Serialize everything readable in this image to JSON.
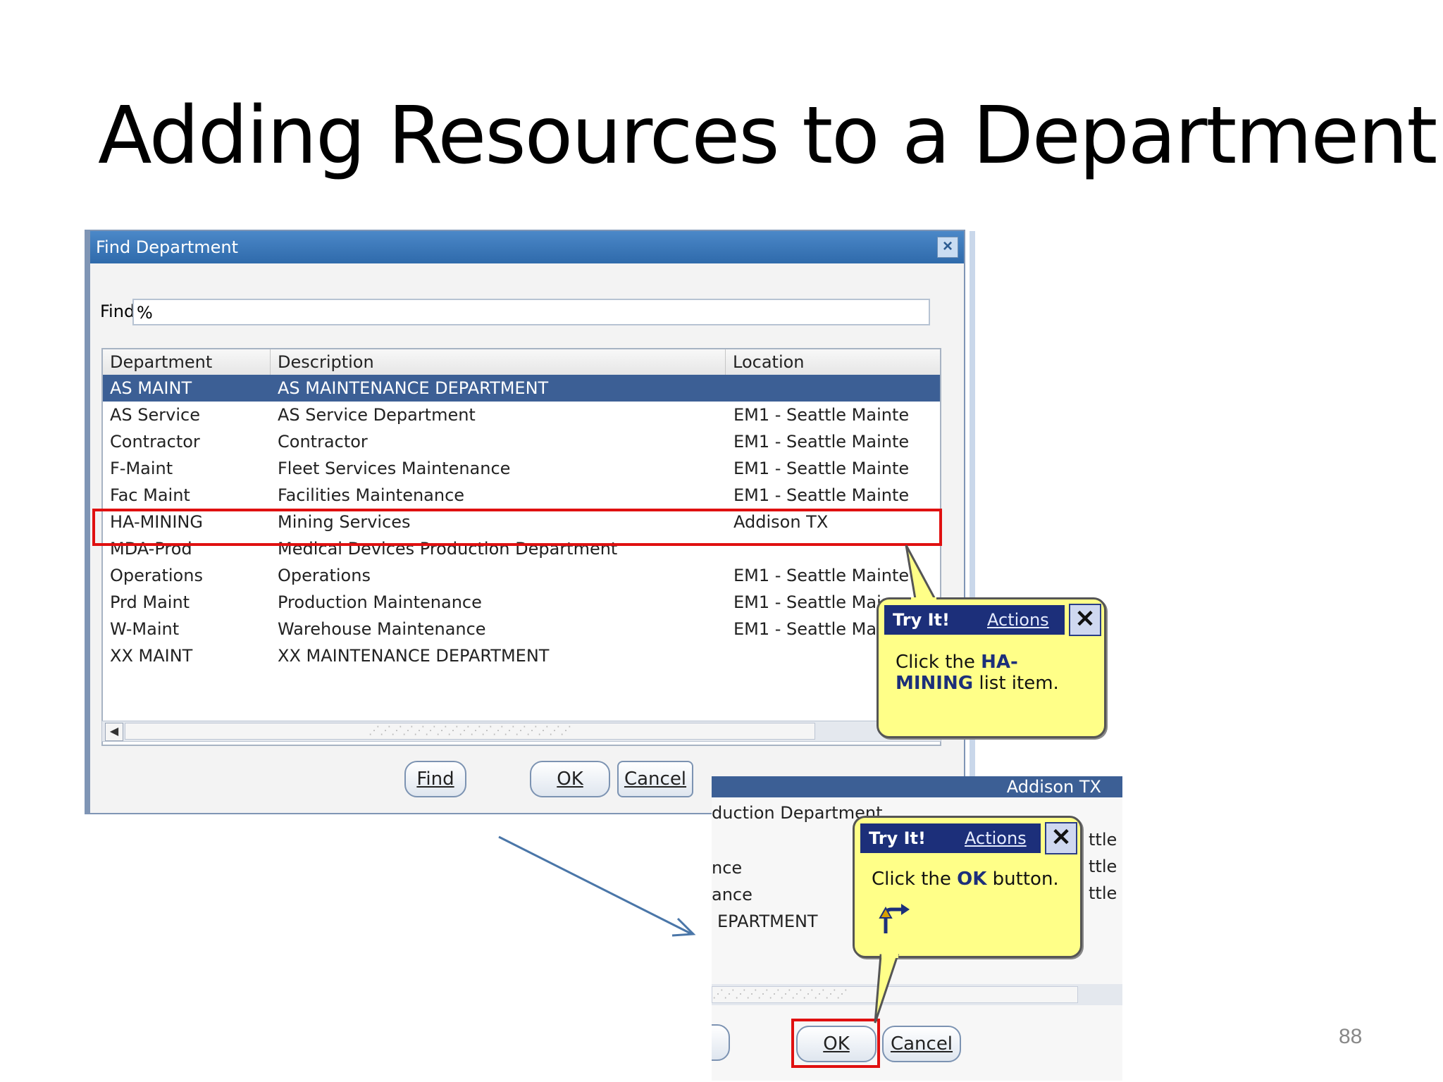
{
  "slide": {
    "title": "Adding Resources to a Department",
    "page_number": "88"
  },
  "dialog": {
    "title": "Find Department",
    "find_label": "Find",
    "find_value": "%",
    "columns": [
      "Department",
      "Description",
      "Location"
    ],
    "rows": [
      {
        "department": "AS MAINT",
        "description": "AS MAINTENANCE DEPARTMENT",
        "location": ""
      },
      {
        "department": "AS Service",
        "description": "AS Service Department",
        "location": "EM1 - Seattle Mainte"
      },
      {
        "department": "Contractor",
        "description": "Contractor",
        "location": "EM1 - Seattle Mainte"
      },
      {
        "department": "F-Maint",
        "description": "Fleet Services Maintenance",
        "location": "EM1 - Seattle Mainte"
      },
      {
        "department": "Fac Maint",
        "description": "Facilities Maintenance",
        "location": "EM1 - Seattle Mainte"
      },
      {
        "department": "HA-MINING",
        "description": "Mining Services",
        "location": "Addison TX"
      },
      {
        "department": "MDA-Prod",
        "description": "Medical Devices Production Department",
        "location": ""
      },
      {
        "department": "Operations",
        "description": "Operations",
        "location": "EM1 - Seattle Mainte"
      },
      {
        "department": "Prd Maint",
        "description": "Production Maintenance",
        "location": "EM1 - Seattle Mair"
      },
      {
        "department": "W-Maint",
        "description": "Warehouse Maintenance",
        "location": "EM1 - Seattle Mai"
      },
      {
        "department": "XX MAINT",
        "description": "XX MAINTENANCE DEPARTMENT",
        "location": ""
      }
    ],
    "buttons": {
      "find": "Find",
      "ok": "OK",
      "cancel": "Cancel"
    }
  },
  "callout_1": {
    "head": "Try It!",
    "actions": "Actions",
    "text_prefix": "Click the ",
    "text_bold": "HA-MINING",
    "text_suffix": " list item."
  },
  "crop": {
    "selected_location": "Addison TX",
    "line_1": "duction Department",
    "line_2": "nce",
    "line_3": "ance",
    "line_4": "EPARTMENT",
    "right_1": "ttle I",
    "right_2": "ttle I",
    "right_3": "ttle I",
    "ok": "OK",
    "cancel": "Cancel"
  },
  "callout_2": {
    "head": "Try It!",
    "actions": "Actions",
    "text_prefix": "Click the ",
    "text_bold": "OK",
    "text_suffix": " button."
  },
  "colors": {
    "titlebar": "#2f6aab",
    "selected_row": "#3c5f95",
    "highlight": "#e01010",
    "callout_bg": "#ffff88",
    "callout_head": "#1c2f7a"
  },
  "icons": [
    "close-icon",
    "scroll-left-icon",
    "turn-arrow-icon"
  ]
}
